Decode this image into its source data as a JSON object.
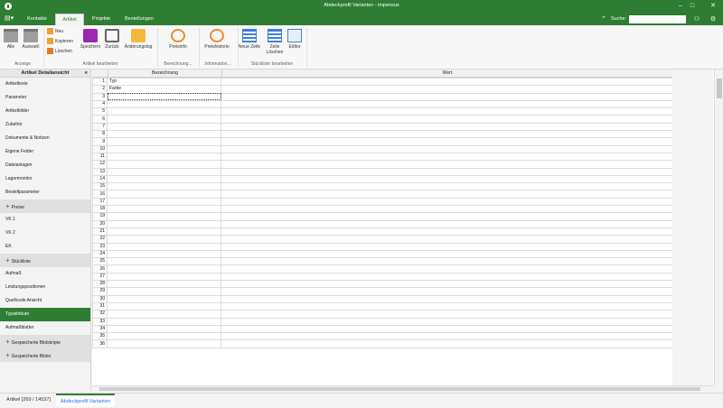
{
  "window": {
    "title": "Abdeckprofil Varianten - impensus"
  },
  "tabs": [
    {
      "label": "Kontakte"
    },
    {
      "label": "Artikel"
    },
    {
      "label": "Projekte"
    },
    {
      "label": "Bestellungen"
    }
  ],
  "search": {
    "label": "Suche:",
    "placeholder": ""
  },
  "ribbon": {
    "anzeige": {
      "alle": "Alle",
      "auswahl": "Auswahl",
      "group": "Anzeige"
    },
    "bearbeiten": {
      "neu": "Neu",
      "kopieren": "Kopieren",
      "loeschen": "Löschen",
      "speichern": "Speichern",
      "zurueck": "Zurück",
      "aenderungslog": "Änderungslog",
      "group": "Artikel bearbeiten"
    },
    "berechnung": {
      "preisinfo": "Preisinfo",
      "group": "Berechnung..."
    },
    "information": {
      "preishistorie": "Preishistorie",
      "group": "Information..."
    },
    "stueckliste": {
      "neue_zeile": "Neue Zeile",
      "zeile_loeschen": "Zeile Löschen",
      "editor": "Editor",
      "group": "Stückliste bearbeiten"
    }
  },
  "sidebar": {
    "header": "Artikel Detailansicht",
    "items": [
      {
        "label": "Artikeltexte"
      },
      {
        "label": "Parameter"
      },
      {
        "label": "Artikelbilder"
      },
      {
        "label": "Zubehör"
      },
      {
        "label": "Dokumente & Notizen"
      },
      {
        "label": "Eigene Felder"
      },
      {
        "label": "Dateianlagen"
      },
      {
        "label": "Lagermonitor"
      },
      {
        "label": "Bestellparameter"
      },
      {
        "label": "Preise"
      },
      {
        "label": "VK 1"
      },
      {
        "label": "VK 2"
      },
      {
        "label": "EK"
      },
      {
        "label": "Stückliste"
      },
      {
        "label": "Aufmaß"
      },
      {
        "label": "Leistungspositionen"
      },
      {
        "label": "Quellcode Ansicht"
      },
      {
        "label": "Typattribute"
      },
      {
        "label": "Aufmaßblatter"
      },
      {
        "label": "Gespeicherte Bildskripte"
      },
      {
        "label": "Gespeicherte Bilder"
      }
    ]
  },
  "grid": {
    "columns": [
      "Bezeichnung",
      "Wert"
    ],
    "rows": [
      {
        "n": "1",
        "bez": "Typ",
        "wert": ""
      },
      {
        "n": "2",
        "bez": "Farbe",
        "wert": ""
      },
      {
        "n": "3",
        "bez": "",
        "wert": ""
      },
      {
        "n": "4",
        "bez": "",
        "wert": ""
      },
      {
        "n": "5",
        "bez": "",
        "wert": ""
      },
      {
        "n": "6",
        "bez": "",
        "wert": ""
      },
      {
        "n": "7",
        "bez": "",
        "wert": ""
      },
      {
        "n": "8",
        "bez": "",
        "wert": ""
      },
      {
        "n": "9",
        "bez": "",
        "wert": ""
      },
      {
        "n": "10",
        "bez": "",
        "wert": ""
      },
      {
        "n": "11",
        "bez": "",
        "wert": ""
      },
      {
        "n": "12",
        "bez": "",
        "wert": ""
      },
      {
        "n": "13",
        "bez": "",
        "wert": ""
      },
      {
        "n": "14",
        "bez": "",
        "wert": ""
      },
      {
        "n": "15",
        "bez": "",
        "wert": ""
      },
      {
        "n": "16",
        "bez": "",
        "wert": ""
      },
      {
        "n": "17",
        "bez": "",
        "wert": ""
      },
      {
        "n": "18",
        "bez": "",
        "wert": ""
      },
      {
        "n": "19",
        "bez": "",
        "wert": ""
      },
      {
        "n": "20",
        "bez": "",
        "wert": ""
      },
      {
        "n": "21",
        "bez": "",
        "wert": ""
      },
      {
        "n": "22",
        "bez": "",
        "wert": ""
      },
      {
        "n": "23",
        "bez": "",
        "wert": ""
      },
      {
        "n": "24",
        "bez": "",
        "wert": ""
      },
      {
        "n": "25",
        "bez": "",
        "wert": ""
      },
      {
        "n": "26",
        "bez": "",
        "wert": ""
      },
      {
        "n": "27",
        "bez": "",
        "wert": ""
      },
      {
        "n": "28",
        "bez": "",
        "wert": ""
      },
      {
        "n": "29",
        "bez": "",
        "wert": ""
      },
      {
        "n": "30",
        "bez": "",
        "wert": ""
      },
      {
        "n": "31",
        "bez": "",
        "wert": ""
      },
      {
        "n": "32",
        "bez": "",
        "wert": ""
      },
      {
        "n": "33",
        "bez": "",
        "wert": ""
      },
      {
        "n": "34",
        "bez": "",
        "wert": ""
      },
      {
        "n": "35",
        "bez": "",
        "wert": ""
      },
      {
        "n": "36",
        "bez": "",
        "wert": ""
      }
    ]
  },
  "bottom_tabs": [
    {
      "label": "Artikel [269 / 14537]"
    },
    {
      "label": "Abdeckprofil Varianten"
    }
  ],
  "colors": {
    "accent": "#2e7d32"
  }
}
